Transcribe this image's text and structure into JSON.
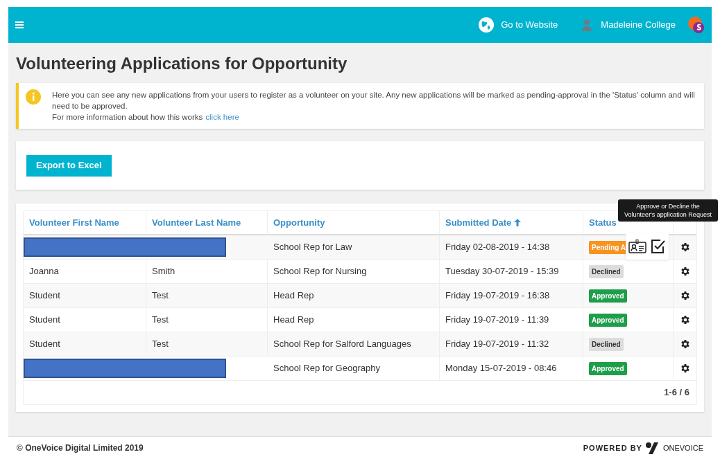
{
  "topbar": {
    "website_link": "Go to Website",
    "user_name": "Madeleine College"
  },
  "page_title": "Volunteering Applications for Opportunity",
  "info": {
    "text": "Here you can see any new applications from your users to register as a volunteer on your site. Any new applications will be marked as pending-approval in the 'Status' column and will need to be approved.",
    "more_text": "For more information about how this works",
    "link": "click here"
  },
  "export_button": "Export to Excel",
  "table": {
    "columns": [
      {
        "label": "Volunteer First Name",
        "sorted": false
      },
      {
        "label": "Volunteer Last Name",
        "sorted": false
      },
      {
        "label": "Opportunity",
        "sorted": false
      },
      {
        "label": "Submitted Date",
        "sorted": true
      },
      {
        "label": "Status",
        "sorted": false
      }
    ],
    "rows": [
      {
        "kind": "redacted",
        "opportunity": "School Rep for Law",
        "date": "Friday 02-08-2019 - 14:38",
        "status": {
          "kind": "pending",
          "label": "Pending A"
        },
        "menu_open": true
      },
      {
        "kind": "normal",
        "first": "Joanna",
        "last": "Smith",
        "opportunity": "School Rep for Nursing",
        "date": "Tuesday 30-07-2019 - 15:39",
        "status": {
          "kind": "declined",
          "label": "Declined"
        },
        "menu_open": false
      },
      {
        "kind": "normal",
        "first": "Student",
        "last": "Test",
        "opportunity": "Head Rep",
        "date": "Friday 19-07-2019 - 16:38",
        "status": {
          "kind": "approved",
          "label": "Approved"
        },
        "menu_open": false
      },
      {
        "kind": "normal",
        "first": "Student",
        "last": "Test",
        "opportunity": "Head Rep",
        "date": "Friday 19-07-2019 - 11:39",
        "status": {
          "kind": "approved",
          "label": "Approved"
        },
        "menu_open": false
      },
      {
        "kind": "normal",
        "first": "Student",
        "last": "Test",
        "opportunity": "School Rep for Salford Languages",
        "date": "Friday 19-07-2019 - 11:32",
        "status": {
          "kind": "declined",
          "label": "Declined"
        },
        "menu_open": false
      },
      {
        "kind": "redacted",
        "opportunity": "School Rep for Geography",
        "date": "Monday 15-07-2019 - 08:46",
        "status": {
          "kind": "approved",
          "label": "Approved"
        },
        "menu_open": false
      }
    ],
    "tooltip": "Approve or Decline the Volunteer's application Request",
    "pagination": "1-6 / 6"
  },
  "footer": {
    "copyright": "© OneVoice Digital Limited 2019",
    "powered_by": "POWERED BY",
    "brand": "ONEVOICE"
  }
}
